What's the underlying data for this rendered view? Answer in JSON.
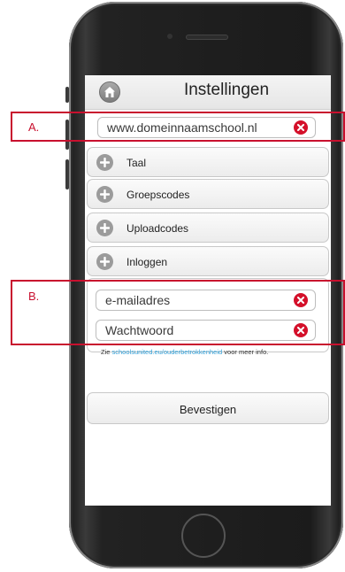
{
  "screen": {
    "title": "Instellingen",
    "domain_field": {
      "value": "www.domeinnaamschool.nl"
    },
    "menu_items": [
      {
        "label": "Taal"
      },
      {
        "label": "Groepscodes"
      },
      {
        "label": "Uploadcodes"
      },
      {
        "label": "Inloggen"
      }
    ],
    "login": {
      "email_placeholder": "e-mailadres",
      "password_placeholder": "Wachtwoord",
      "info_prefix": "Zie",
      "info_link": "schoolsunited.eu/ouderbetrokkenheid",
      "info_suffix": "voor meer info."
    },
    "confirm_label": "Bevestigen"
  },
  "annotations": {
    "a_label": "A.",
    "b_label": "B."
  },
  "colors": {
    "accent_red": "#c8102e",
    "clear_icon": "#d4102a",
    "link": "#2f9fd8"
  },
  "icons": [
    "home-icon",
    "plus-icon",
    "clear-icon"
  ]
}
